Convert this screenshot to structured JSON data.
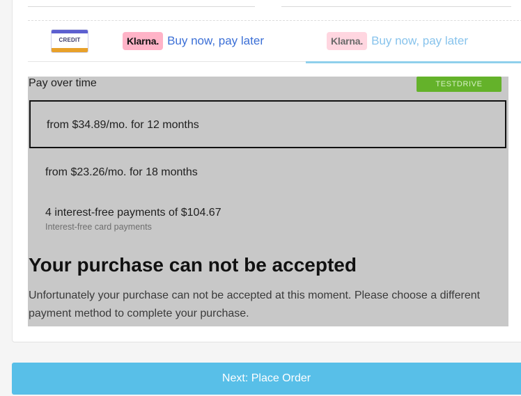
{
  "tabs": {
    "credit_label": "CREDIT",
    "klarna_brand": "Klarna.",
    "klarna1_text": "Buy now, pay later",
    "klarna2_text": "Buy now, pay later"
  },
  "panel": {
    "title": "Pay over time",
    "badge": "TESTDRIVE",
    "options": [
      {
        "label": "from $34.89/mo. for 12 months",
        "selected": true
      },
      {
        "label": "from $23.26/mo. for 18 months",
        "selected": false
      },
      {
        "label": "4 interest-free payments of $104.67",
        "sublabel": "Interest-free card payments",
        "selected": false
      }
    ],
    "error_title": "Your purchase can not be accepted",
    "error_message": "Unfortunately your purchase can not be accepted at this moment. Please choose a different payment method to complete your purchase."
  },
  "footer": {
    "next_label": "Next: Place Order"
  },
  "colors": {
    "next_button": "#58bfe8",
    "testdrive_badge": "#64b22a",
    "klarna_pink": "#ffb3c7",
    "active_tab_underline": "#8fd0ec",
    "link_blue": "#3b6fd6"
  }
}
